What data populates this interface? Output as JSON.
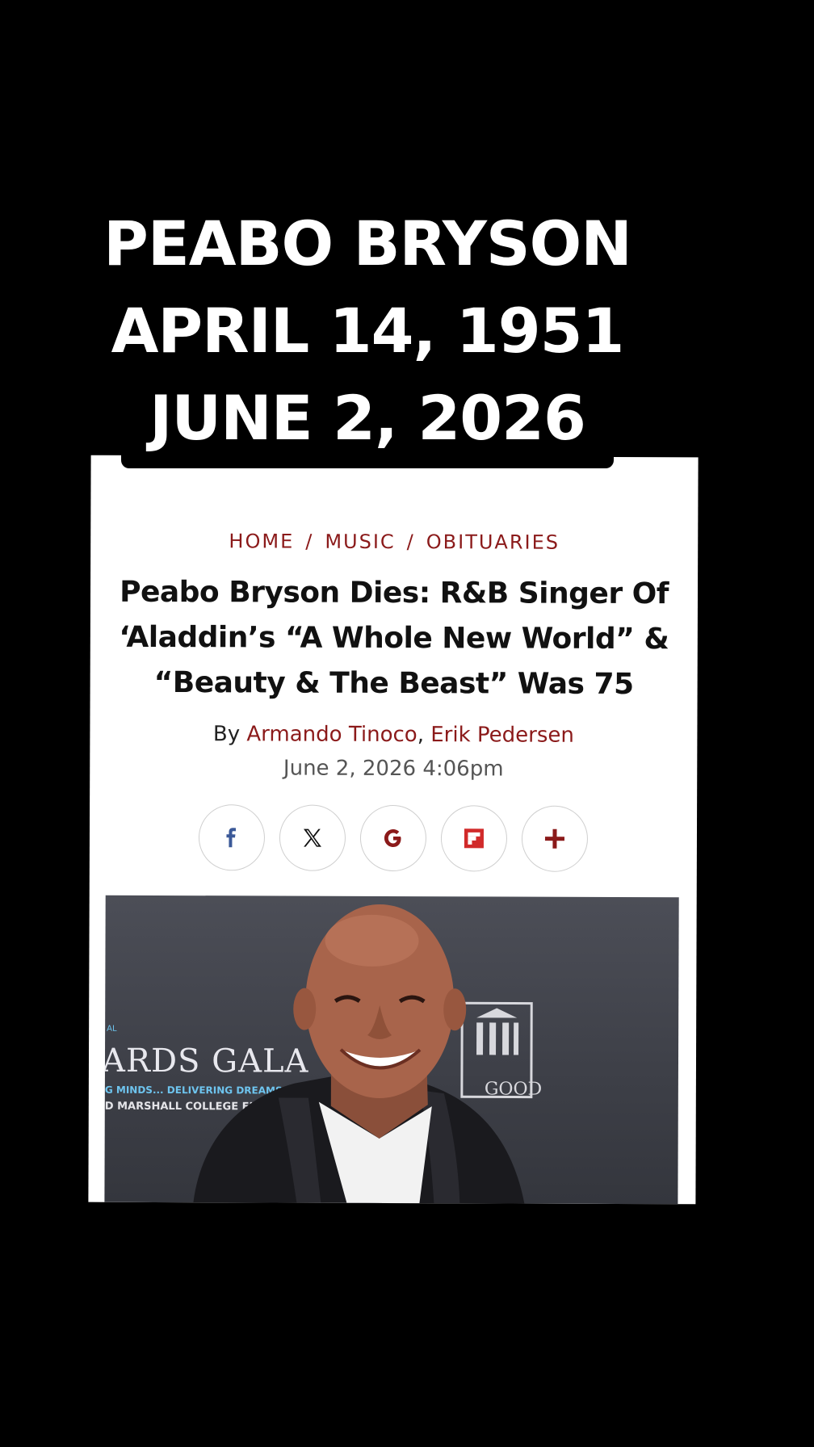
{
  "overlay_caption": {
    "line1": "PEABO BRYSON",
    "line2": "APRIL 14, 1951",
    "line3": "JUNE 2, 2026"
  },
  "article": {
    "breadcrumb": {
      "home": "HOME",
      "separator": "/",
      "music": "MUSIC",
      "obituaries": "OBITUARIES"
    },
    "headline": "Peabo Bryson Dies: R&B Singer Of ‘Aladdin’s “A Whole New World” & “Beauty & The Beast” Was 75",
    "byline": {
      "prefix": "By ",
      "author1": "Armando Tinoco",
      "comma": ", ",
      "author2": "Erik Pedersen"
    },
    "date": "June 2, 2026 4:06pm",
    "share_buttons": [
      {
        "icon": "facebook-icon",
        "color": "#3b5998"
      },
      {
        "icon": "x-icon",
        "color": "#111111"
      },
      {
        "icon": "google-icon",
        "color": "#8b1a1a"
      },
      {
        "icon": "flipboard-icon",
        "color": "#d12a2a"
      },
      {
        "icon": "plus-icon",
        "color": "#8b1a1a"
      }
    ],
    "photo": {
      "backdrop_text": "ARDS GALA",
      "backdrop_small": "AL",
      "backdrop_sub1": "G MINDS... DELIVERING DREAMS",
      "backdrop_sub2": "D MARSHALL COLLEGE FUND",
      "backdrop_right": "GOOD"
    }
  },
  "colors": {
    "accent": "#8b1a1a",
    "background": "#000000",
    "card": "#ffffff"
  }
}
